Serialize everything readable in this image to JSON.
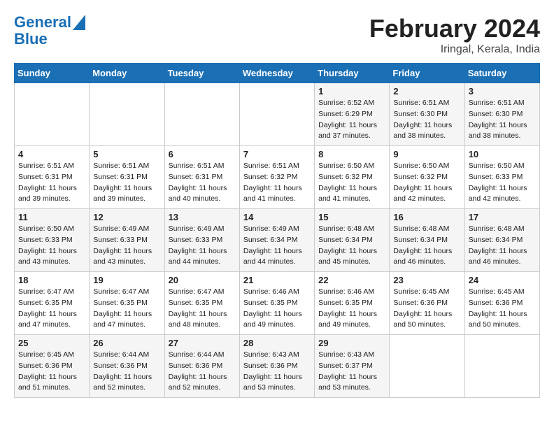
{
  "logo": {
    "line1": "General",
    "line2": "Blue"
  },
  "title": "February 2024",
  "location": "Iringal, Kerala, India",
  "days_of_week": [
    "Sunday",
    "Monday",
    "Tuesday",
    "Wednesday",
    "Thursday",
    "Friday",
    "Saturday"
  ],
  "weeks": [
    [
      {
        "num": "",
        "sunrise": "",
        "sunset": "",
        "daylight": ""
      },
      {
        "num": "",
        "sunrise": "",
        "sunset": "",
        "daylight": ""
      },
      {
        "num": "",
        "sunrise": "",
        "sunset": "",
        "daylight": ""
      },
      {
        "num": "",
        "sunrise": "",
        "sunset": "",
        "daylight": ""
      },
      {
        "num": "1",
        "sunrise": "Sunrise: 6:52 AM",
        "sunset": "Sunset: 6:29 PM",
        "daylight": "Daylight: 11 hours and 37 minutes."
      },
      {
        "num": "2",
        "sunrise": "Sunrise: 6:51 AM",
        "sunset": "Sunset: 6:30 PM",
        "daylight": "Daylight: 11 hours and 38 minutes."
      },
      {
        "num": "3",
        "sunrise": "Sunrise: 6:51 AM",
        "sunset": "Sunset: 6:30 PM",
        "daylight": "Daylight: 11 hours and 38 minutes."
      }
    ],
    [
      {
        "num": "4",
        "sunrise": "Sunrise: 6:51 AM",
        "sunset": "Sunset: 6:31 PM",
        "daylight": "Daylight: 11 hours and 39 minutes."
      },
      {
        "num": "5",
        "sunrise": "Sunrise: 6:51 AM",
        "sunset": "Sunset: 6:31 PM",
        "daylight": "Daylight: 11 hours and 39 minutes."
      },
      {
        "num": "6",
        "sunrise": "Sunrise: 6:51 AM",
        "sunset": "Sunset: 6:31 PM",
        "daylight": "Daylight: 11 hours and 40 minutes."
      },
      {
        "num": "7",
        "sunrise": "Sunrise: 6:51 AM",
        "sunset": "Sunset: 6:32 PM",
        "daylight": "Daylight: 11 hours and 41 minutes."
      },
      {
        "num": "8",
        "sunrise": "Sunrise: 6:50 AM",
        "sunset": "Sunset: 6:32 PM",
        "daylight": "Daylight: 11 hours and 41 minutes."
      },
      {
        "num": "9",
        "sunrise": "Sunrise: 6:50 AM",
        "sunset": "Sunset: 6:32 PM",
        "daylight": "Daylight: 11 hours and 42 minutes."
      },
      {
        "num": "10",
        "sunrise": "Sunrise: 6:50 AM",
        "sunset": "Sunset: 6:33 PM",
        "daylight": "Daylight: 11 hours and 42 minutes."
      }
    ],
    [
      {
        "num": "11",
        "sunrise": "Sunrise: 6:50 AM",
        "sunset": "Sunset: 6:33 PM",
        "daylight": "Daylight: 11 hours and 43 minutes."
      },
      {
        "num": "12",
        "sunrise": "Sunrise: 6:49 AM",
        "sunset": "Sunset: 6:33 PM",
        "daylight": "Daylight: 11 hours and 43 minutes."
      },
      {
        "num": "13",
        "sunrise": "Sunrise: 6:49 AM",
        "sunset": "Sunset: 6:33 PM",
        "daylight": "Daylight: 11 hours and 44 minutes."
      },
      {
        "num": "14",
        "sunrise": "Sunrise: 6:49 AM",
        "sunset": "Sunset: 6:34 PM",
        "daylight": "Daylight: 11 hours and 44 minutes."
      },
      {
        "num": "15",
        "sunrise": "Sunrise: 6:48 AM",
        "sunset": "Sunset: 6:34 PM",
        "daylight": "Daylight: 11 hours and 45 minutes."
      },
      {
        "num": "16",
        "sunrise": "Sunrise: 6:48 AM",
        "sunset": "Sunset: 6:34 PM",
        "daylight": "Daylight: 11 hours and 46 minutes."
      },
      {
        "num": "17",
        "sunrise": "Sunrise: 6:48 AM",
        "sunset": "Sunset: 6:34 PM",
        "daylight": "Daylight: 11 hours and 46 minutes."
      }
    ],
    [
      {
        "num": "18",
        "sunrise": "Sunrise: 6:47 AM",
        "sunset": "Sunset: 6:35 PM",
        "daylight": "Daylight: 11 hours and 47 minutes."
      },
      {
        "num": "19",
        "sunrise": "Sunrise: 6:47 AM",
        "sunset": "Sunset: 6:35 PM",
        "daylight": "Daylight: 11 hours and 47 minutes."
      },
      {
        "num": "20",
        "sunrise": "Sunrise: 6:47 AM",
        "sunset": "Sunset: 6:35 PM",
        "daylight": "Daylight: 11 hours and 48 minutes."
      },
      {
        "num": "21",
        "sunrise": "Sunrise: 6:46 AM",
        "sunset": "Sunset: 6:35 PM",
        "daylight": "Daylight: 11 hours and 49 minutes."
      },
      {
        "num": "22",
        "sunrise": "Sunrise: 6:46 AM",
        "sunset": "Sunset: 6:35 PM",
        "daylight": "Daylight: 11 hours and 49 minutes."
      },
      {
        "num": "23",
        "sunrise": "Sunrise: 6:45 AM",
        "sunset": "Sunset: 6:36 PM",
        "daylight": "Daylight: 11 hours and 50 minutes."
      },
      {
        "num": "24",
        "sunrise": "Sunrise: 6:45 AM",
        "sunset": "Sunset: 6:36 PM",
        "daylight": "Daylight: 11 hours and 50 minutes."
      }
    ],
    [
      {
        "num": "25",
        "sunrise": "Sunrise: 6:45 AM",
        "sunset": "Sunset: 6:36 PM",
        "daylight": "Daylight: 11 hours and 51 minutes."
      },
      {
        "num": "26",
        "sunrise": "Sunrise: 6:44 AM",
        "sunset": "Sunset: 6:36 PM",
        "daylight": "Daylight: 11 hours and 52 minutes."
      },
      {
        "num": "27",
        "sunrise": "Sunrise: 6:44 AM",
        "sunset": "Sunset: 6:36 PM",
        "daylight": "Daylight: 11 hours and 52 minutes."
      },
      {
        "num": "28",
        "sunrise": "Sunrise: 6:43 AM",
        "sunset": "Sunset: 6:36 PM",
        "daylight": "Daylight: 11 hours and 53 minutes."
      },
      {
        "num": "29",
        "sunrise": "Sunrise: 6:43 AM",
        "sunset": "Sunset: 6:37 PM",
        "daylight": "Daylight: 11 hours and 53 minutes."
      },
      {
        "num": "",
        "sunrise": "",
        "sunset": "",
        "daylight": ""
      },
      {
        "num": "",
        "sunrise": "",
        "sunset": "",
        "daylight": ""
      }
    ]
  ]
}
